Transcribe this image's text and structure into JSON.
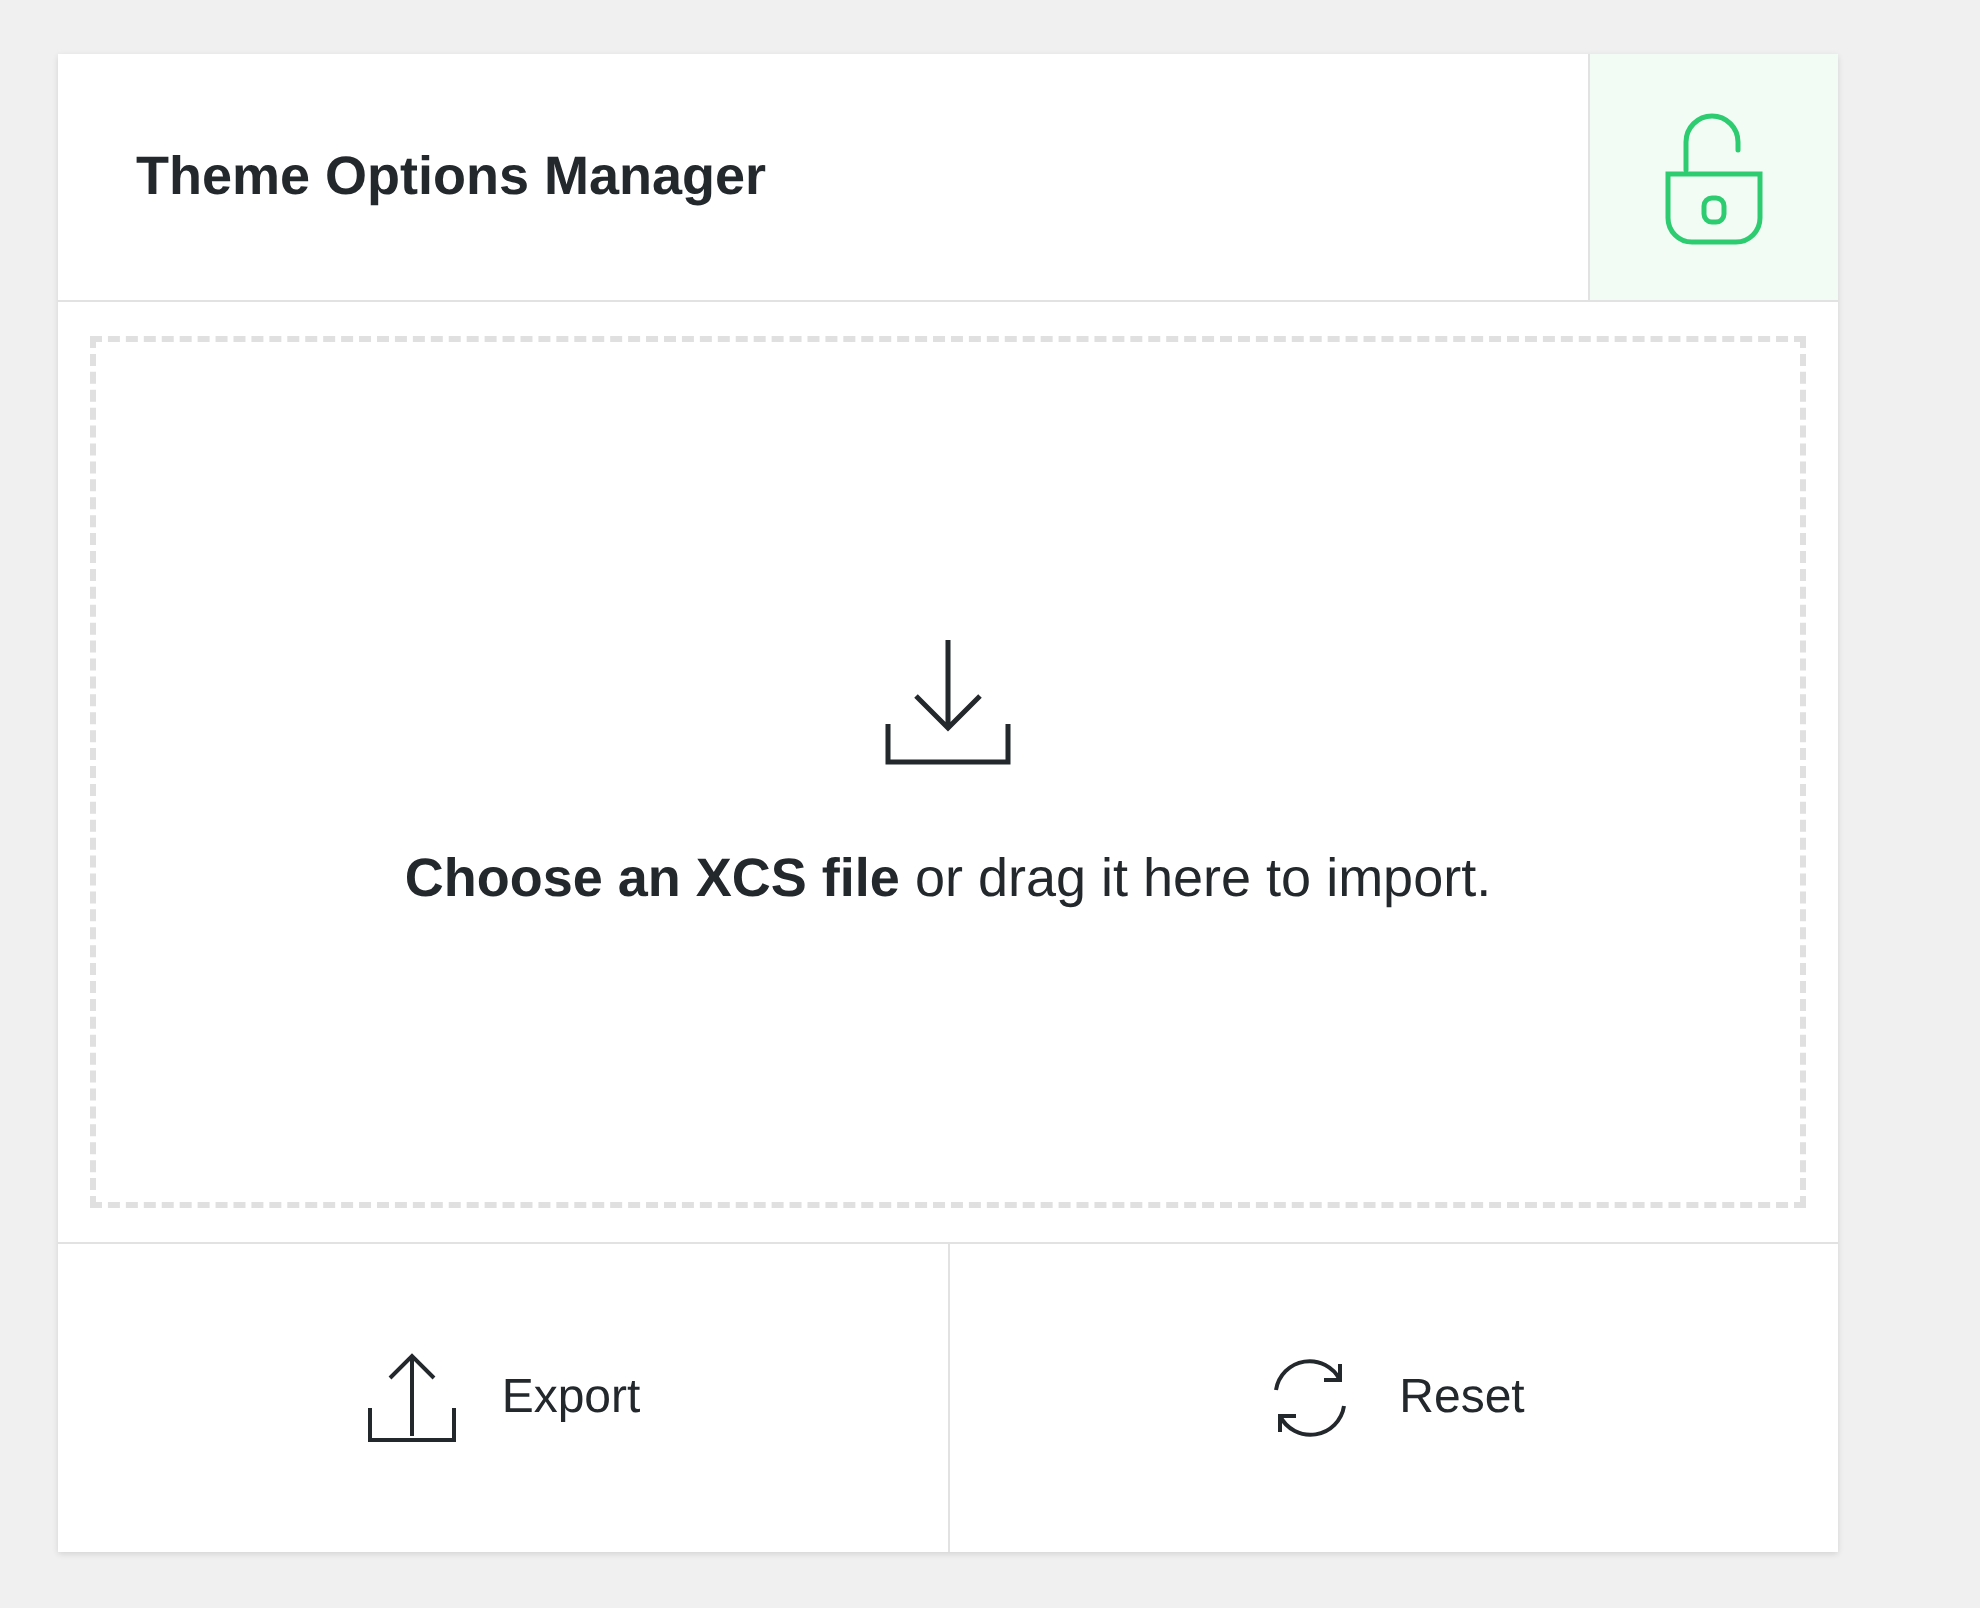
{
  "header": {
    "title": "Theme Options Manager",
    "lock": {
      "locked": false
    }
  },
  "dropzone": {
    "text": "**Choose an XCS file** or drag it here to import."
  },
  "actions": [
    {
      "kind": "export",
      "label": "Export"
    },
    {
      "kind": "reset",
      "label": "Reset"
    }
  ]
}
